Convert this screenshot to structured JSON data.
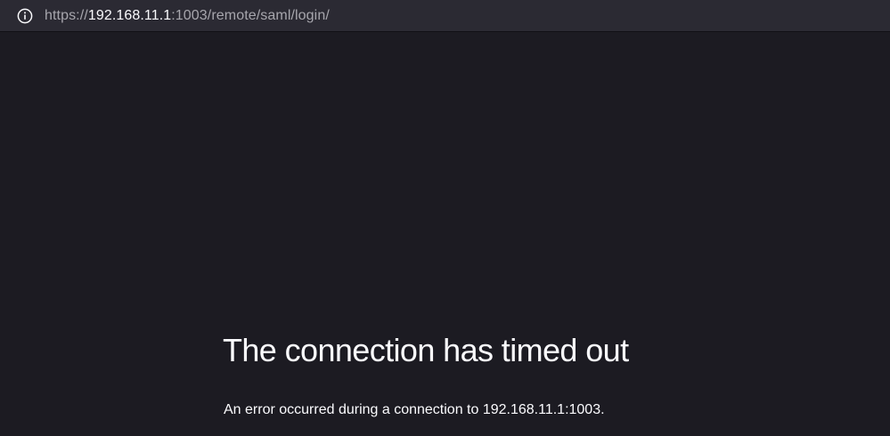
{
  "address_bar": {
    "icon": "info-icon",
    "url_scheme": "https://",
    "url_host": "192.168.11.1",
    "url_rest": ":1003/remote/saml/login/"
  },
  "error_page": {
    "title": "The connection has timed out",
    "description": "An error occurred during a connection to 192.168.11.1:1003."
  },
  "colors": {
    "page_background": "#1c1b22",
    "toolbar_background": "#2b2a33",
    "text_primary": "#fbfbfe",
    "text_secondary": "#a7a6ad"
  }
}
